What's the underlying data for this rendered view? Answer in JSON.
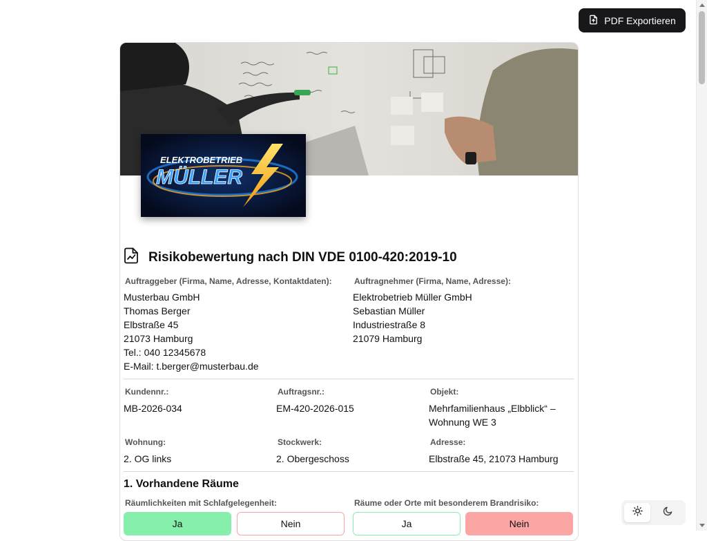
{
  "toolbar": {
    "export_label": "PDF Exportieren"
  },
  "logo": {
    "line1": "ELEKTROBETRIEB",
    "line2": "MÜLLER"
  },
  "document": {
    "title": "Risikobewertung nach DIN VDE 0100-420:2019-10",
    "client": {
      "label": "Auftraggeber (Firma, Name, Adresse, Kontaktdaten):",
      "lines": [
        "Musterbau GmbH",
        "Thomas Berger",
        "Elbstraße 45",
        "21073 Hamburg",
        "Tel.: 040 12345678",
        "E-Mail: t.berger@musterbau.de"
      ]
    },
    "contractor": {
      "label": "Auftragnehmer (Firma, Name, Adresse):",
      "lines": [
        "Elektrobetrieb Müller GmbH",
        "Sebastian Müller",
        "Industriestraße 8",
        "21079 Hamburg"
      ]
    },
    "fields": {
      "kundennr": {
        "label": "Kundennr.:",
        "value": "MB-2026-034"
      },
      "auftragsnr": {
        "label": "Auftragsnr.:",
        "value": "EM-420-2026-015"
      },
      "objekt": {
        "label": "Objekt:",
        "line1": "Mehrfamilienhaus „Elbblick“ –",
        "line2": "Wohnung WE 3"
      },
      "wohnung": {
        "label": "Wohnung:",
        "value": "2. OG links"
      },
      "stockwerk": {
        "label": "Stockwerk:",
        "value": "2. Obergeschoss"
      },
      "adresse": {
        "label": "Adresse:",
        "value": "Elbstraße 45, 21073 Hamburg"
      }
    },
    "section1": {
      "title": "1. Vorhandene Räume",
      "q1": {
        "label": "Räumlichkeiten mit Schlafgelegenheit:",
        "yes": "Ja",
        "no": "Nein",
        "selected": "yes"
      },
      "q2": {
        "label": "Räume oder Orte mit besonderem Brandrisiko:",
        "yes": "Ja",
        "no": "Nein",
        "selected": "no"
      }
    }
  },
  "colors": {
    "yes_selected": "#86efac",
    "no_selected": "#fca5a5",
    "yes_border": "#86efac",
    "no_border": "#fca5a5",
    "dark_button": "#18181b"
  },
  "icons": {
    "export": "file-export-icon",
    "title": "file-chart-icon",
    "theme_light": "sun-icon",
    "theme_dark": "moon-icon"
  }
}
